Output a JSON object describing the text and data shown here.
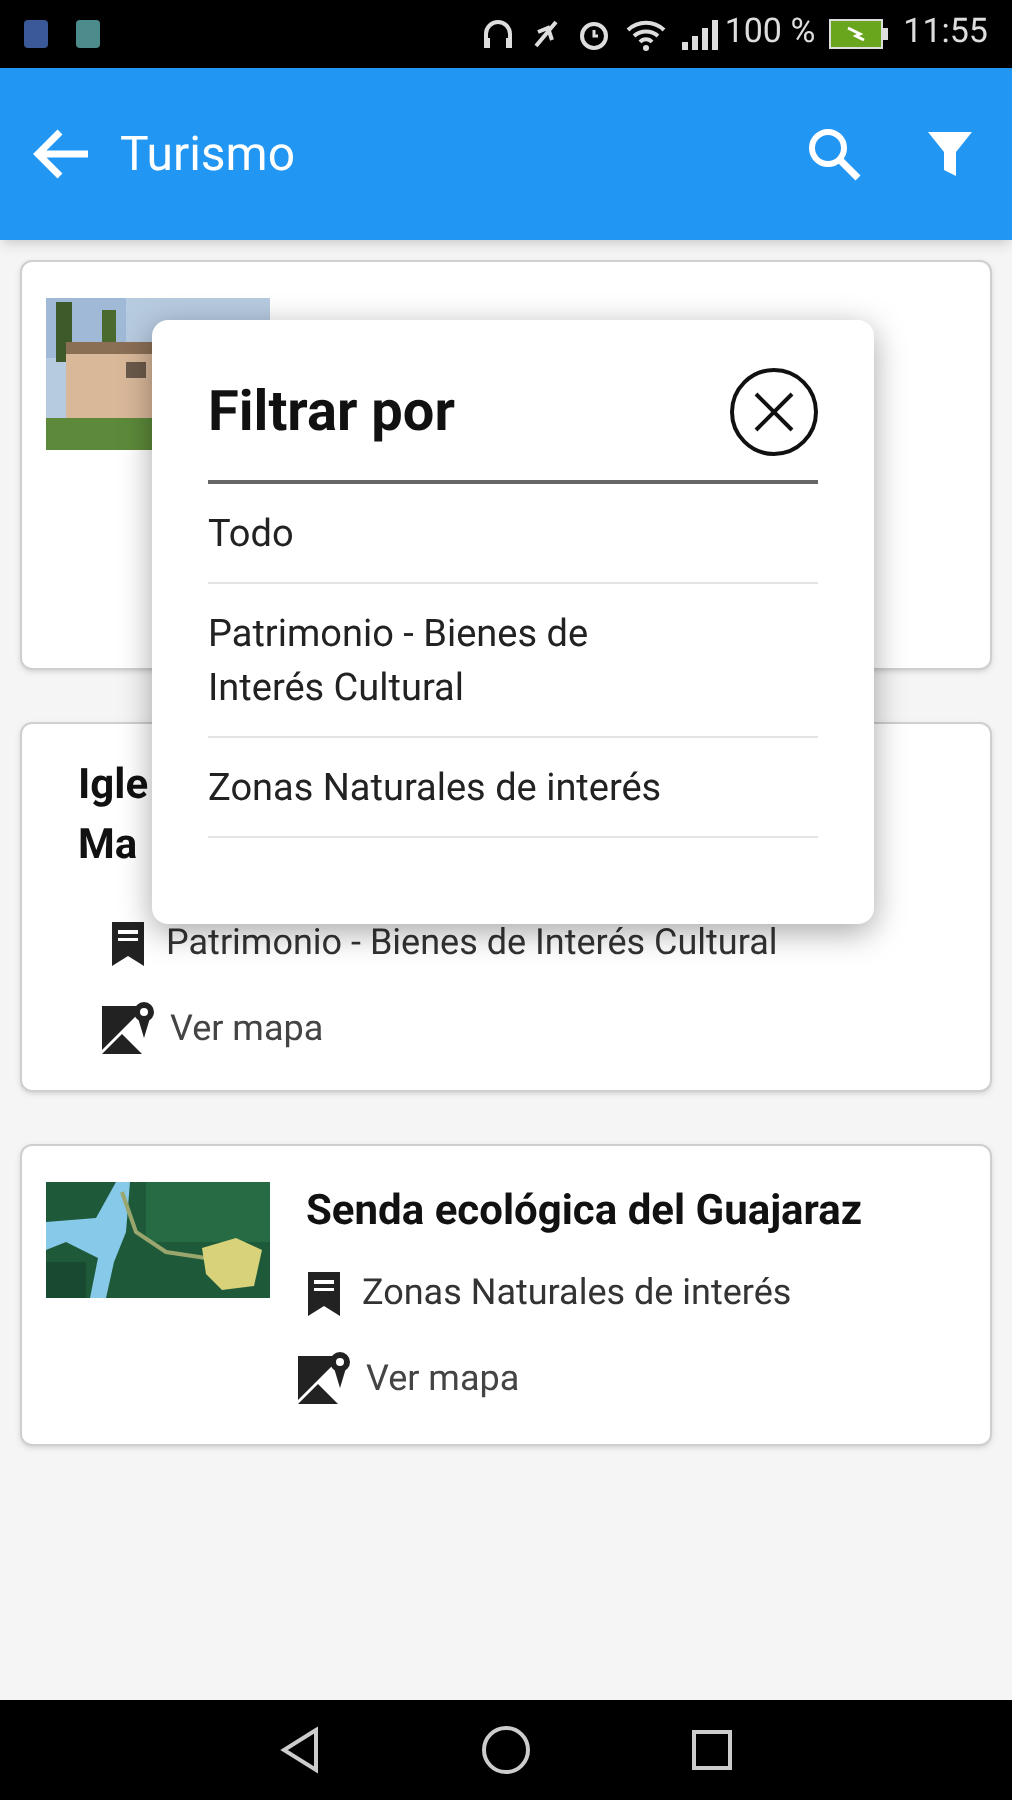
{
  "status_bar": {
    "battery": "100 %",
    "time": "11:55"
  },
  "app_bar": {
    "title": "Turismo"
  },
  "cards": [
    {
      "kind": "picture_card"
    },
    {
      "kind": "text_card",
      "title_lines": [
        "Igle",
        "Ma"
      ],
      "category": "Patrimonio - Bienes de Interés Cultural",
      "map_link": "Ver mapa"
    },
    {
      "kind": "picture_card",
      "title": "Senda ecológica del Guajaraz",
      "category": "Zonas Naturales de interés",
      "map_link": "Ver mapa"
    }
  ],
  "filter_dialog": {
    "title": "Filtrar por",
    "options": [
      "Todo",
      "Patrimonio - Bienes de Interés Cultural",
      "Zonas Naturales de interés"
    ]
  }
}
